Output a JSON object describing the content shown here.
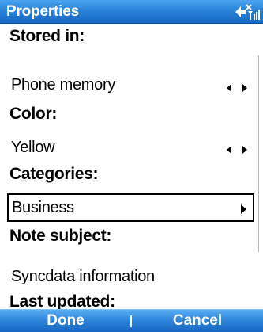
{
  "title_bar": {
    "title": "Properties",
    "status_icon": "connection-signal-icon"
  },
  "fields": {
    "stored_in": {
      "label": "Stored in:",
      "value": "Phone memory",
      "control_icon": "left-right-arrows-icon"
    },
    "color": {
      "label": "Color:",
      "value": "Yellow",
      "control_icon": "left-right-arrows-icon"
    },
    "categories": {
      "label": "Categories:",
      "value": "Business",
      "control_icon": "right-arrow-icon"
    },
    "note_subject": {
      "label": "Note subject:",
      "value": "Syncdata information"
    },
    "last_updated": {
      "label": "Last updated:"
    }
  },
  "softkeys": {
    "left": "Done",
    "right": "Cancel"
  },
  "colors": {
    "title_bar": "#2a82d8",
    "softkey_bar": "#2f86da",
    "text": "#000000",
    "background": "#ffffff"
  }
}
